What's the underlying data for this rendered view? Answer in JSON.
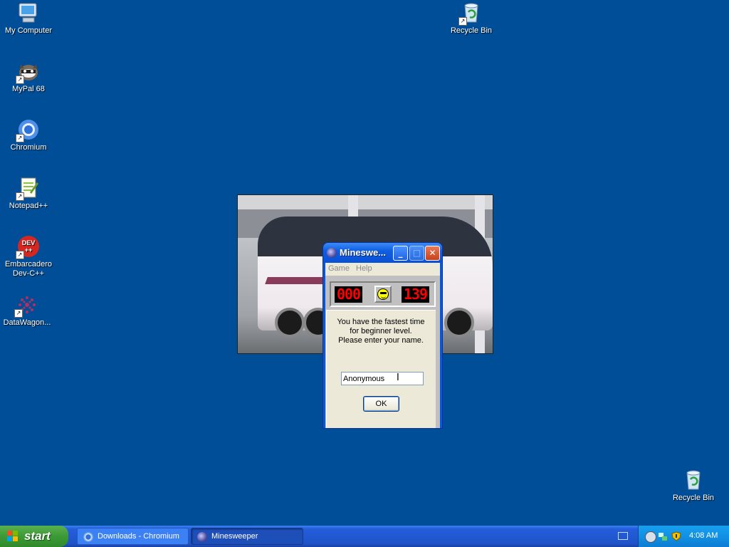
{
  "desktop": {
    "icons": [
      {
        "label": "My Computer",
        "icon": "my-computer-icon"
      },
      {
        "label": "MyPal 68",
        "icon": "mypal-icon"
      },
      {
        "label": "Chromium",
        "icon": "chromium-icon"
      },
      {
        "label": "Notepad++",
        "icon": "notepad-plus-plus-icon"
      },
      {
        "label": "Embarcadero Dev-C++",
        "icon": "devcpp-icon",
        "icon_text": "DEV ++"
      },
      {
        "label": "DataWagon...",
        "icon": "datawagon-icon"
      },
      {
        "label": "Recycle Bin",
        "icon": "recycle-bin-icon"
      },
      {
        "label": "Recycle Bin",
        "icon": "recycle-bin-icon"
      }
    ]
  },
  "minesweeper": {
    "title": "Minesweeper",
    "title_display": "Mineswe...",
    "menu": [
      "Game",
      "Help"
    ],
    "mine_counter": "000",
    "timer": "139",
    "smiley_state": "cool",
    "dialog": {
      "message_lines": [
        "You have the fastest time",
        "for beginner level.",
        "Please enter your name."
      ],
      "name_value": "Anonymous",
      "ok_label": "OK"
    }
  },
  "taskbar": {
    "start_label": "start",
    "tasks": [
      {
        "label": "Downloads - Chromium",
        "icon": "chromium-icon",
        "active": false
      },
      {
        "label": "Minesweeper",
        "icon": "minesweeper-icon",
        "active": true
      }
    ],
    "clock": "4:08 AM"
  },
  "colors": {
    "desktop_bg": "#004e98",
    "taskbar_blue": "#245edb",
    "start_green": "#3c9a36",
    "lcd_red": "#ff0000"
  }
}
